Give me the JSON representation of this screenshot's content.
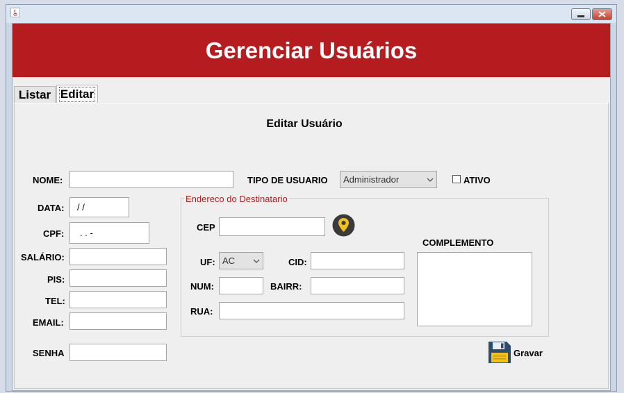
{
  "window": {},
  "header": {
    "title": "Gerenciar Usuários"
  },
  "tabs": [
    {
      "label": "Listar"
    },
    {
      "label": "Editar"
    }
  ],
  "form": {
    "section_title": "Editar Usuário",
    "nome": {
      "label": "NOME:",
      "value": ""
    },
    "tipo_usuario": {
      "label": "TIPO DE USUARIO",
      "value": "Administrador"
    },
    "ativo": {
      "label": "ATIVO",
      "checked": false
    },
    "data": {
      "label": "DATA:",
      "value": "/ /"
    },
    "cpf": {
      "label": "CPF:",
      "value": ".   .   -"
    },
    "salario": {
      "label": "SALÁRIO:",
      "value": ""
    },
    "pis": {
      "label": "PIS:",
      "value": ""
    },
    "tel": {
      "label": "TEL:",
      "value": ""
    },
    "email": {
      "label": "EMAIL:",
      "value": ""
    },
    "senha": {
      "label": "SENHA",
      "value": ""
    }
  },
  "address": {
    "group_title": "Endereco do Destinatario",
    "cep": {
      "label": "CEP",
      "value": ""
    },
    "uf": {
      "label": "UF:",
      "value": "AC"
    },
    "cid": {
      "label": "CID:",
      "value": ""
    },
    "num": {
      "label": "NUM:",
      "value": ""
    },
    "bairr": {
      "label": "BAIRR:",
      "value": ""
    },
    "rua": {
      "label": "RUA:",
      "value": ""
    },
    "complemento": {
      "label": "COMPLEMENTO",
      "value": ""
    }
  },
  "actions": {
    "save_label": "Gravar"
  },
  "icons": {
    "app": "java-app-icon",
    "cep_search": "location-pin-icon",
    "save": "floppy-disk-icon",
    "minimize": "minimize-icon",
    "close": "close-icon"
  },
  "colors": {
    "header_bg": "#b51c1f",
    "header_text": "#ffffff",
    "group_title": "#a82020",
    "pin_bg": "#3a3a3a",
    "pin_fg": "#f2c21b",
    "save_icon": "#2f4d6b"
  }
}
